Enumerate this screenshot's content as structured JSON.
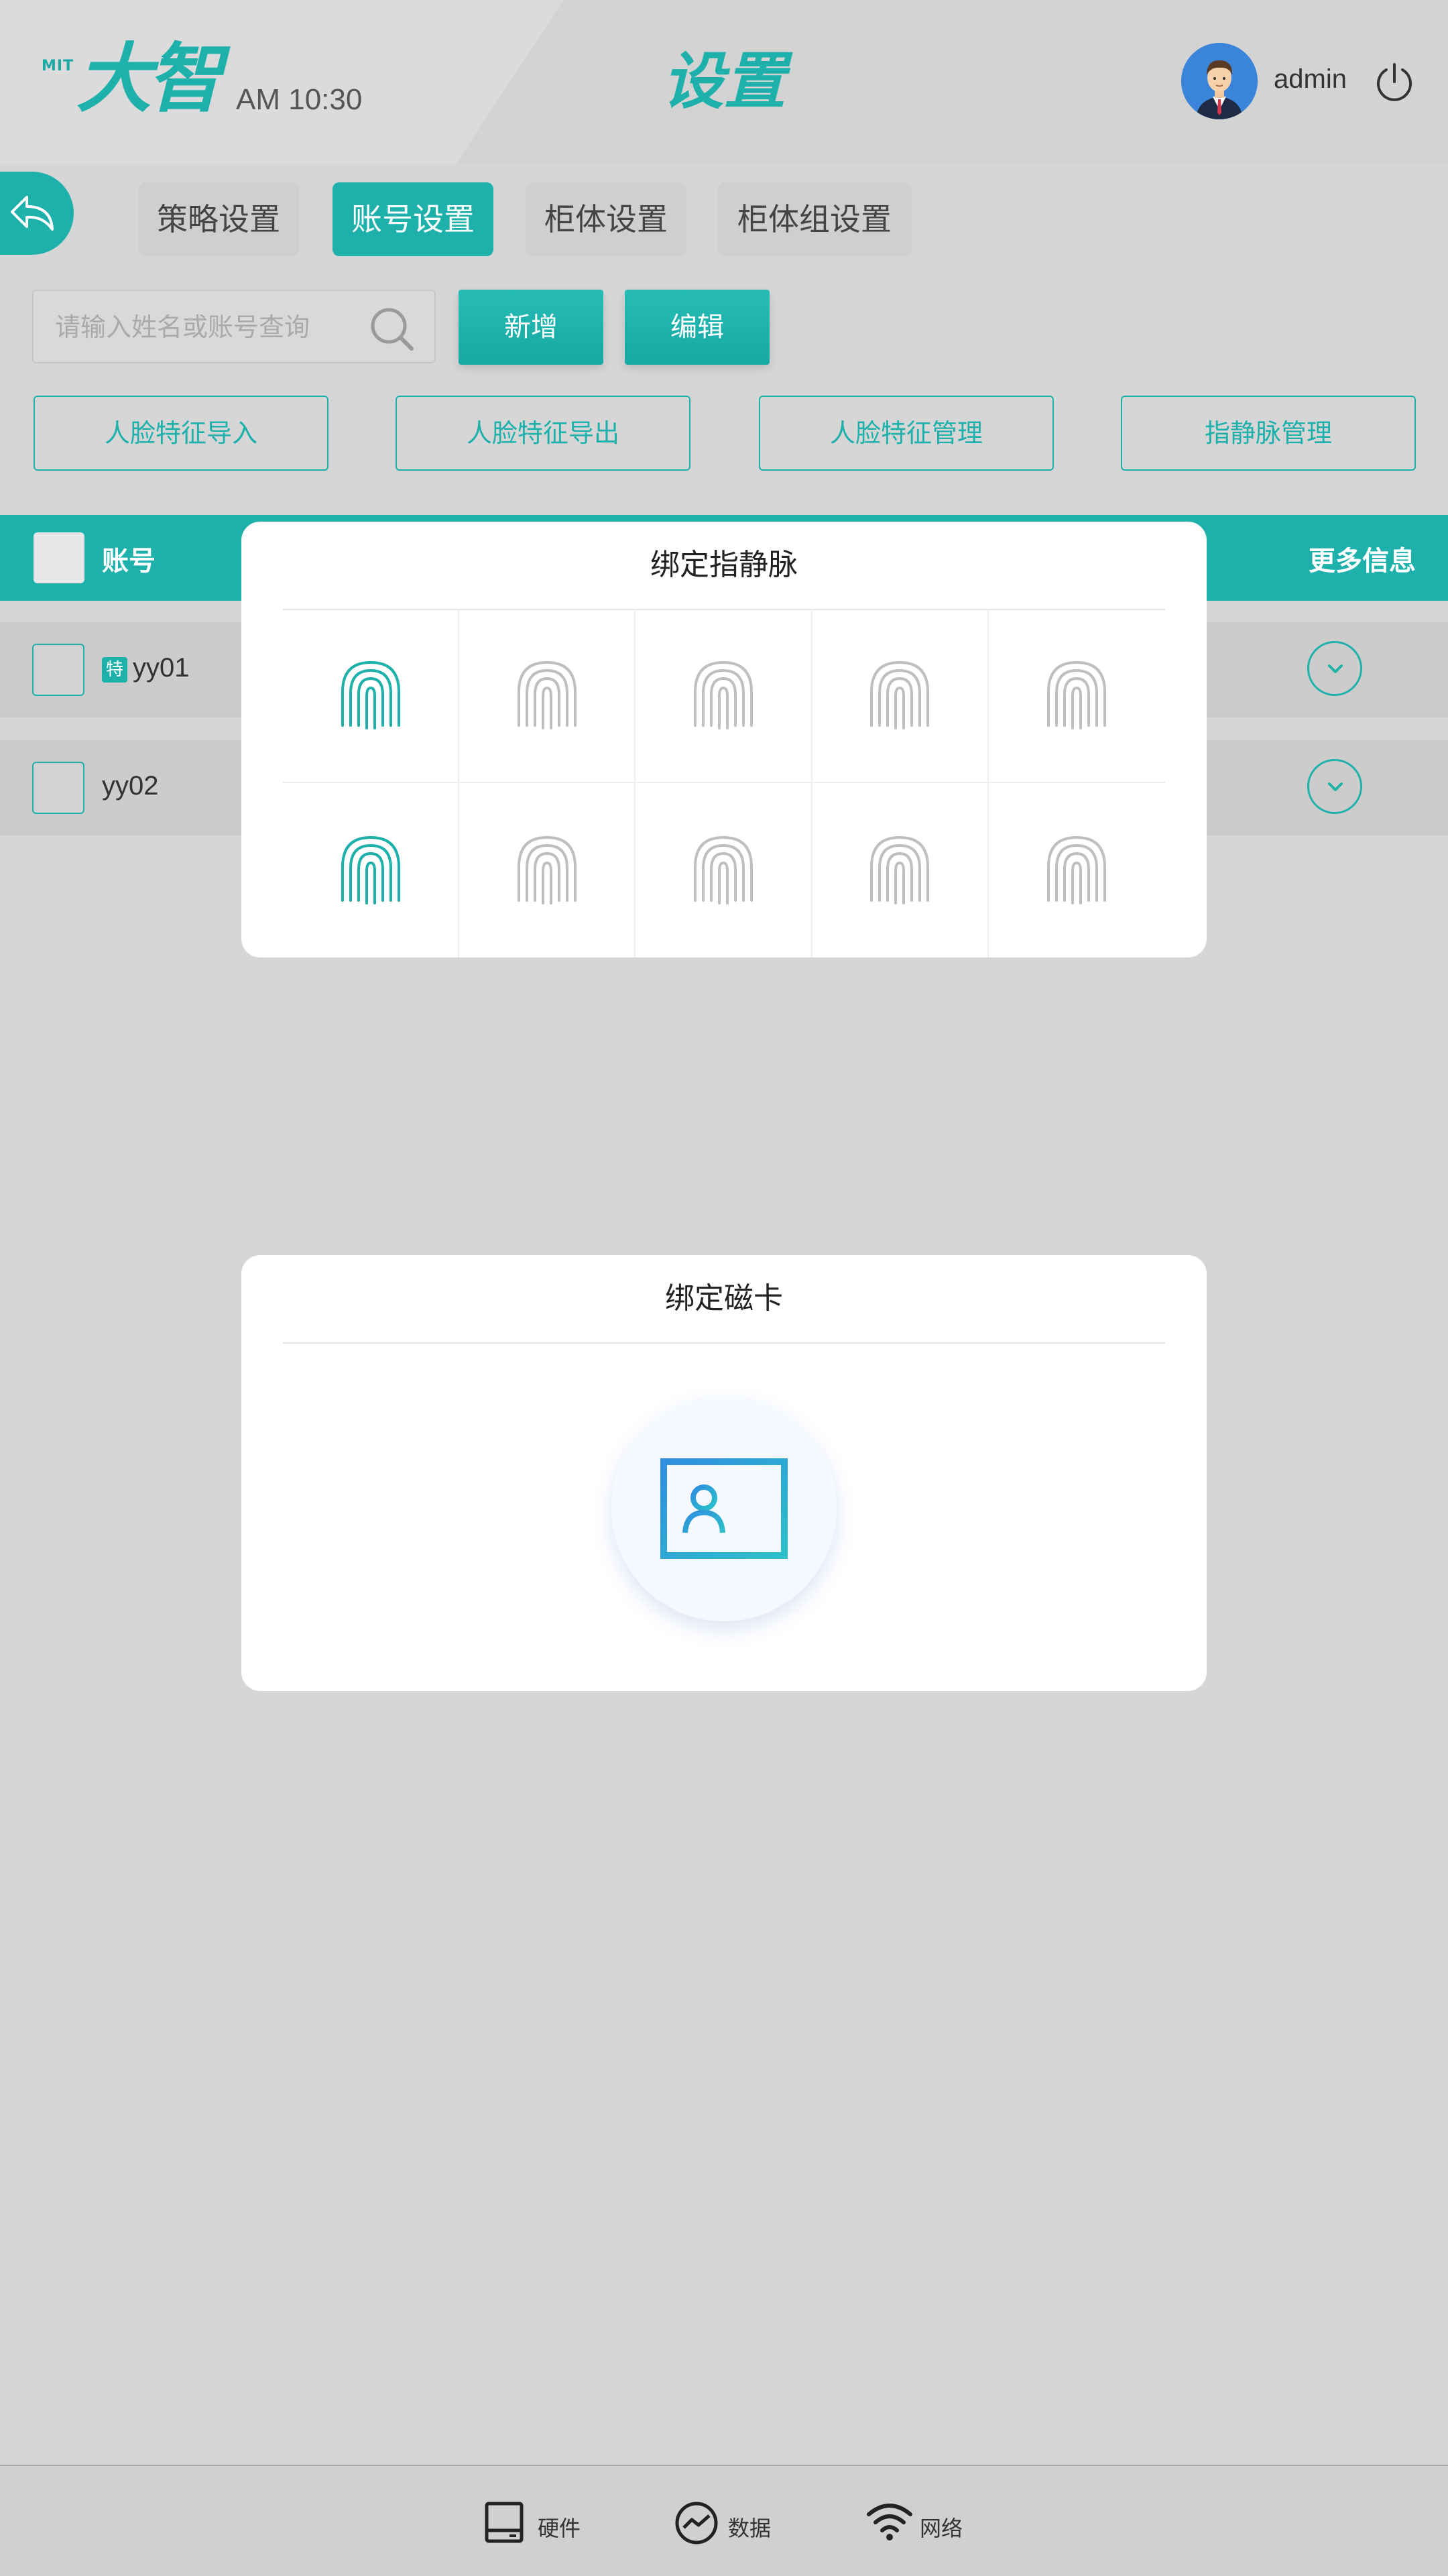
{
  "header": {
    "logo_prefix": "MIT",
    "logo_text": "大智",
    "time": "AM 10:30",
    "title": "设置",
    "username": "admin"
  },
  "tabs": [
    {
      "label": "策略设置",
      "active": false
    },
    {
      "label": "账号设置",
      "active": true
    },
    {
      "label": "柜体设置",
      "active": false
    },
    {
      "label": "柜体组设置",
      "active": false
    }
  ],
  "search": {
    "placeholder": "请输入姓名或账号查询",
    "value": ""
  },
  "actions": {
    "add": "新增",
    "edit": "编辑"
  },
  "feature_buttons": [
    "人脸特征导入",
    "人脸特征导出",
    "人脸特征管理",
    "指静脉管理"
  ],
  "table": {
    "col_account": "账号",
    "col_more": "更多信息",
    "rows": [
      {
        "account": "yy01",
        "badge": "特"
      },
      {
        "account": "yy02",
        "badge": ""
      }
    ]
  },
  "finger_modal": {
    "title": "绑定指静脉",
    "fingers_bound": [
      true,
      false,
      false,
      false,
      false,
      true,
      false,
      false,
      false,
      false
    ]
  },
  "card_modal": {
    "title": "绑定磁卡"
  },
  "footer": {
    "hardware": "硬件",
    "data": "数据",
    "network": "网络"
  },
  "colors": {
    "accent": "#1eb1ac",
    "inactive_fp": "#bfbfbf",
    "card_icon": "#2fa6d8"
  },
  "icons": {
    "back": "back-arrow-icon",
    "power": "power-icon",
    "search": "search-icon",
    "expand": "chevron-down-icon",
    "fingerprint": "fingerprint-icon",
    "card": "id-card-icon",
    "hardware": "hardware-icon",
    "data": "data-chart-icon",
    "network": "wifi-icon"
  }
}
